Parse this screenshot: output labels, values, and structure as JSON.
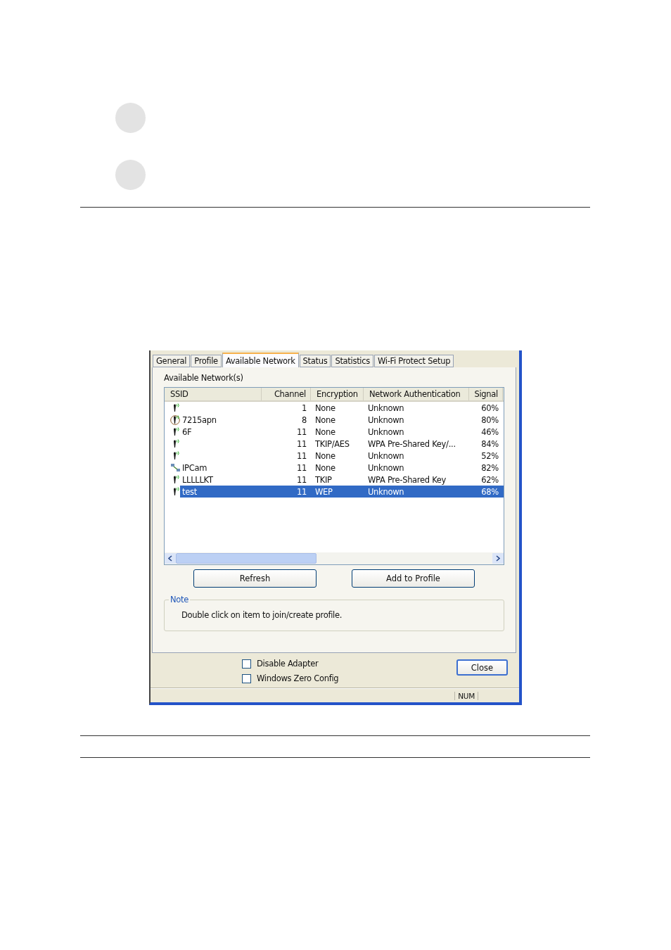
{
  "dialog": {
    "tabs": [
      {
        "label": "General",
        "selected": false
      },
      {
        "label": "Profile",
        "selected": false
      },
      {
        "label": "Available Network",
        "selected": true
      },
      {
        "label": "Status",
        "selected": false
      },
      {
        "label": "Statistics",
        "selected": false
      },
      {
        "label": "Wi-Fi Protect Setup",
        "selected": false
      }
    ],
    "section_title": "Available Network(s)",
    "table": {
      "columns": [
        "SSID",
        "Channel",
        "Encryption",
        "Network Authentication",
        "Signal"
      ],
      "rows": [
        {
          "kind": "ap",
          "channel": "1",
          "encryption": "None",
          "authentication": "Unknown",
          "signal": "60%",
          "selected": false
        },
        {
          "kind": "ap-circled",
          "ssid": "7215apn",
          "channel": "8",
          "encryption": "None",
          "authentication": "Unknown",
          "signal": "80%",
          "selected": false
        },
        {
          "kind": "ap",
          "ssid": "6F",
          "channel": "11",
          "encryption": "None",
          "authentication": "Unknown",
          "signal": "46%",
          "selected": false
        },
        {
          "kind": "ap",
          "channel": "11",
          "encryption": "TKIP/AES",
          "authentication": "WPA Pre-Shared Key/...",
          "signal": "84%",
          "selected": false
        },
        {
          "kind": "ap",
          "channel": "11",
          "encryption": "None",
          "authentication": "Unknown",
          "signal": "52%",
          "selected": false
        },
        {
          "kind": "adhoc",
          "ssid": "IPCam",
          "channel": "11",
          "encryption": "None",
          "authentication": "Unknown",
          "signal": "82%",
          "selected": false
        },
        {
          "kind": "ap",
          "ssid": "LLLLLKT",
          "channel": "11",
          "encryption": "TKIP",
          "authentication": "WPA Pre-Shared Key",
          "signal": "62%",
          "selected": false
        },
        {
          "kind": "ap",
          "ssid": "test",
          "channel": "11",
          "encryption": "WEP",
          "authentication": "Unknown",
          "signal": "68%",
          "selected": true
        }
      ]
    },
    "buttons": [
      "Refresh",
      "Add to Profile"
    ],
    "note": {
      "title": "Note",
      "text": "Double click on item to join/create profile."
    },
    "options": [
      {
        "label": "Disable Adapter",
        "checked": false
      },
      {
        "label": "Windows Zero Config",
        "checked": false
      }
    ],
    "close_button": "Close",
    "status_bar": "NUM"
  }
}
